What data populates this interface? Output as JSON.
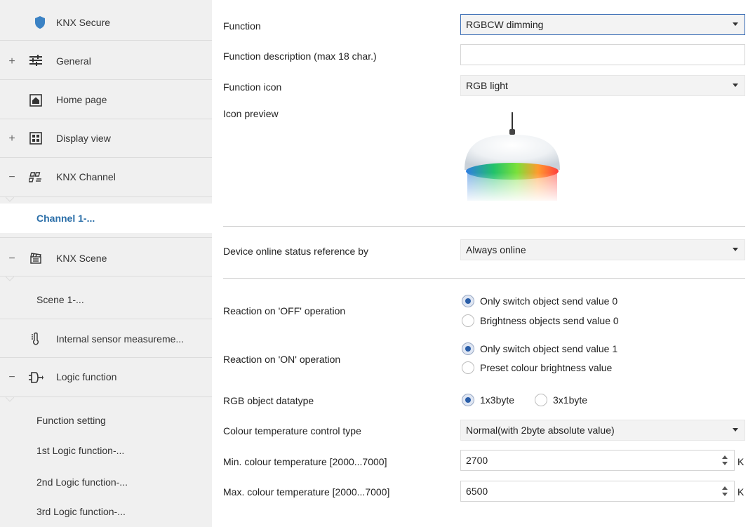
{
  "sidebar": {
    "items": [
      {
        "label": "KNX Secure",
        "icon": "shield-icon"
      },
      {
        "label": "General",
        "icon": "sliders-icon",
        "expander": "+"
      },
      {
        "label": "Home page",
        "icon": "home-icon"
      },
      {
        "label": "Display view",
        "icon": "grid-icon",
        "expander": "+"
      },
      {
        "label": "KNX Channel",
        "icon": "channel-icon",
        "expander": "−"
      },
      {
        "label": "Channel 1-..."
      },
      {
        "label": "KNX Scene",
        "icon": "clapper-icon",
        "expander": "−"
      },
      {
        "label": "Scene 1-..."
      },
      {
        "label": "Internal sensor measureme...",
        "icon": "thermometer-icon"
      },
      {
        "label": "Logic function",
        "icon": "logic-icon",
        "expander": "−"
      },
      {
        "label": "Function setting"
      },
      {
        "label": "1st Logic function-..."
      },
      {
        "label": "2nd Logic function-..."
      },
      {
        "label": "3rd Logic function-..."
      }
    ]
  },
  "main": {
    "function": {
      "label": "Function",
      "value": "RGBCW dimming"
    },
    "description": {
      "label": "Function description (max 18 char.)",
      "value": ""
    },
    "icon": {
      "label": "Function icon",
      "value": "RGB light"
    },
    "preview": {
      "label": "Icon preview"
    },
    "online": {
      "label": "Device online status reference by",
      "value": "Always online"
    },
    "off_reaction": {
      "label": "Reaction on 'OFF' operation",
      "options": [
        "Only switch object send value 0",
        "Brightness objects send value 0"
      ],
      "selected": 0
    },
    "on_reaction": {
      "label": "Reaction on 'ON' operation",
      "options": [
        "Only switch object send value 1",
        "Preset colour brightness value"
      ],
      "selected": 0
    },
    "datatype": {
      "label": "RGB object datatype",
      "options": [
        "1x3byte",
        "3x1byte"
      ],
      "selected": 0
    },
    "ct_type": {
      "label": "Colour temperature control type",
      "value": "Normal(with 2byte absolute value)"
    },
    "ct_min": {
      "label": "Min. colour temperature [2000...7000]",
      "value": "2700",
      "unit": "K"
    },
    "ct_max": {
      "label": "Max. colour temperature [2000...7000]",
      "value": "6500",
      "unit": "K"
    }
  },
  "colors": {
    "accent": "#2a6ea8",
    "focus_border": "#3d6fb6",
    "shield": "#3b82c4"
  }
}
